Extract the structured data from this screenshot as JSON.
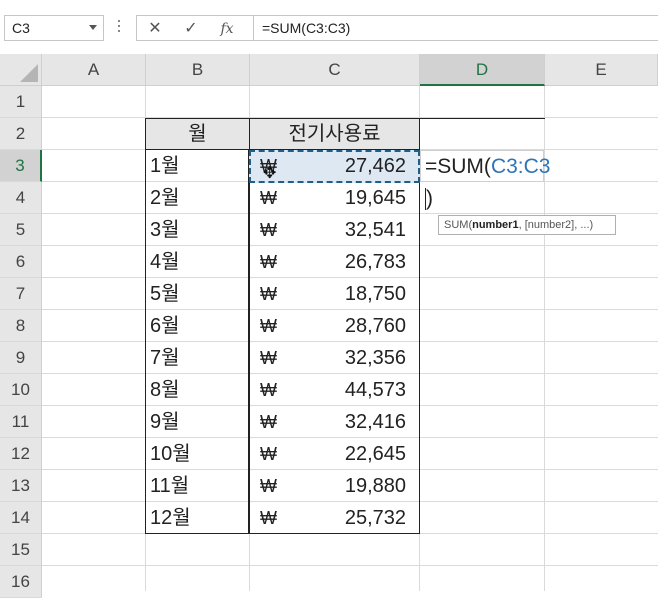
{
  "namebox": {
    "value": "C3"
  },
  "formula_bar": {
    "cancel": "✕",
    "enter": "✓",
    "fx": "fx",
    "text": "=SUM(C3:C3)"
  },
  "columns": [
    "A",
    "B",
    "C",
    "D",
    "E"
  ],
  "rows": [
    "1",
    "2",
    "3",
    "4",
    "5",
    "6",
    "7",
    "8",
    "9",
    "10",
    "11",
    "12",
    "13",
    "14",
    "15",
    "16"
  ],
  "table": {
    "header_month": "월",
    "header_usage": "전기사용료",
    "currency": "₩",
    "months": [
      "1월",
      "2월",
      "3월",
      "4월",
      "5월",
      "6월",
      "7월",
      "8월",
      "9월",
      "10월",
      "11월",
      "12월"
    ],
    "values": [
      "27,462",
      "19,645",
      "32,541",
      "26,783",
      "18,750",
      "28,760",
      "32,356",
      "44,573",
      "32,416",
      "22,645",
      "19,880",
      "25,732"
    ]
  },
  "editing": {
    "prefix": "=SUM(",
    "ref": "C3:C3",
    "suffix": ")"
  },
  "tooltip": {
    "fn": "SUM(",
    "arg1": "number1",
    "rest": ", [number2], ...)"
  },
  "colors": {
    "selected_header": "#217346",
    "reference": "#2e75b6",
    "active_fill": "#dde8f3"
  }
}
